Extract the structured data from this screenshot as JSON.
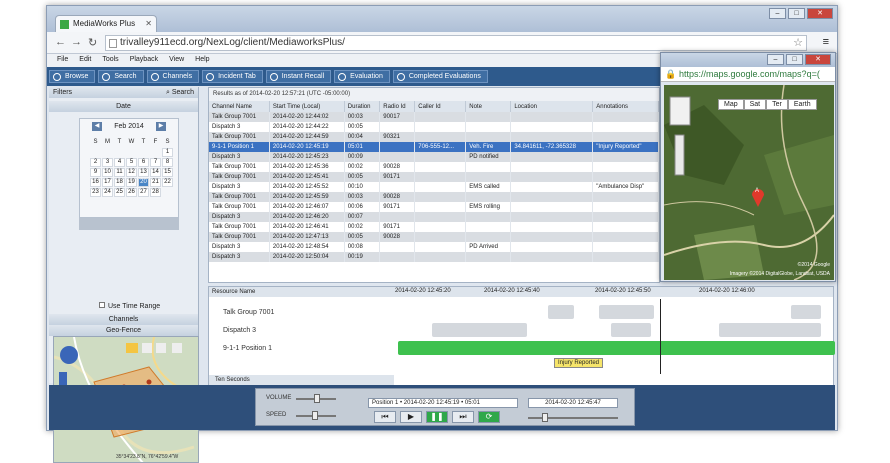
{
  "browser": {
    "tab_title": "MediaWorks Plus",
    "url": "trivalley911ecd.org/NexLog/client/MediaworksPlus/"
  },
  "menu": [
    "File",
    "Edit",
    "Tools",
    "Playback",
    "View",
    "Help"
  ],
  "toolbar": [
    "Browse",
    "Search",
    "Channels",
    "Incident Tab",
    "Instant Recall",
    "Evaluation",
    "Completed Evaluations"
  ],
  "left": {
    "filters_label": "Filters",
    "search_label": "Search",
    "date_label": "Date",
    "month": "Feb 2014",
    "weekdays": [
      "S",
      "M",
      "T",
      "W",
      "T",
      "F",
      "S"
    ],
    "days": [
      "",
      "",
      "",
      "",
      "",
      "",
      "1",
      "2",
      "3",
      "4",
      "5",
      "6",
      "7",
      "8",
      "9",
      "10",
      "11",
      "12",
      "13",
      "14",
      "15",
      "16",
      "17",
      "18",
      "19",
      "20",
      "21",
      "22",
      "23",
      "24",
      "25",
      "26",
      "27",
      "28",
      ""
    ],
    "selected_day": "20",
    "use_time_range": "Use Time Range",
    "channels_label": "Channels",
    "geofence_label": "Geo-Fence",
    "coords": "35°34'23.8\"N, 76°42'59.4\"W"
  },
  "results": {
    "header": "Results as of 2014-02-20 12:57:21 (UTC -05:00:00)",
    "columns": [
      "Channel Name",
      "Start Time (Local)",
      "Duration",
      "Radio Id",
      "Caller Id",
      "Note",
      "Location",
      "Annotations"
    ],
    "rows": [
      [
        "Talk Group 7001",
        "2014-02-20 12:44:02",
        "00:03",
        "90017",
        "",
        "",
        "",
        ""
      ],
      [
        "Dispatch 3",
        "2014-02-20 12:44:22",
        "00:05",
        "",
        "",
        "",
        "",
        ""
      ],
      [
        "Talk Group 7001",
        "2014-02-20 12:44:59",
        "00:04",
        "90321",
        "",
        "",
        "",
        ""
      ],
      [
        "9-1-1 Position 1",
        "2014-02-20 12:45:19",
        "05:01",
        "",
        "706-555-12...",
        "Veh. Fire",
        "34.841611, -72.365328",
        "\"Injury Reported\""
      ],
      [
        "Dispatch 3",
        "2014-02-20 12:45:23",
        "00:09",
        "",
        "",
        "PD notified",
        "",
        ""
      ],
      [
        "Talk Group 7001",
        "2014-02-20 12:45:36",
        "00:02",
        "90028",
        "",
        "",
        "",
        ""
      ],
      [
        "Talk Group 7001",
        "2014-02-20 12:45:41",
        "00:05",
        "90171",
        "",
        "",
        "",
        ""
      ],
      [
        "Dispatch 3",
        "2014-02-20 12:45:52",
        "00:10",
        "",
        "",
        "EMS called",
        "",
        "\"Ambulance Disp\""
      ],
      [
        "Talk Group 7001",
        "2014-02-20 12:45:59",
        "00:03",
        "90028",
        "",
        "",
        "",
        ""
      ],
      [
        "Talk Group 7001",
        "2014-02-20 12:46:07",
        "00:06",
        "90171",
        "",
        "EMS rolling",
        "",
        ""
      ],
      [
        "Dispatch 3",
        "2014-02-20 12:46:20",
        "00:07",
        "",
        "",
        "",
        "",
        ""
      ],
      [
        "Talk Group 7001",
        "2014-02-20 12:46:41",
        "00:02",
        "90171",
        "",
        "",
        "",
        ""
      ],
      [
        "Talk Group 7001",
        "2014-02-20 12:47:13",
        "00:05",
        "90028",
        "",
        "",
        "",
        ""
      ],
      [
        "Dispatch 3",
        "2014-02-20 12:48:54",
        "00:08",
        "",
        "",
        "PD Arrived",
        "",
        ""
      ],
      [
        "Dispatch 3",
        "2014-02-20 12:50:04",
        "00:19",
        "",
        "",
        "",
        "",
        ""
      ]
    ]
  },
  "maps": {
    "url": "https://maps.google.com/maps?q=(",
    "types": [
      "Map",
      "Sat",
      "Ter",
      "Earth"
    ],
    "marker": "A",
    "credit": "©2014 Google",
    "imagery": "Imagery ©2014 DigitalGlobe, Landsat, USDA"
  },
  "timeline": {
    "resource_label": "Resource Name",
    "times": [
      "2014-02-20 12:45:20",
      "2014-02-20 12:45:40",
      "2014-02-20 12:45:50",
      "2014-02-20 12:46:00"
    ],
    "resources": [
      "Talk Group 7001",
      "Dispatch 3",
      "9-1-1 Position 1"
    ],
    "tooltip": "Injury Reported",
    "ten_seconds": "Ten Seconds"
  },
  "controls": {
    "volume": "VOLUME",
    "speed": "SPEED",
    "position_info": "Position 1 • 2014-02-20 12:45:19 • 05:01",
    "current_time": "2014-02-20 12:45:47"
  }
}
